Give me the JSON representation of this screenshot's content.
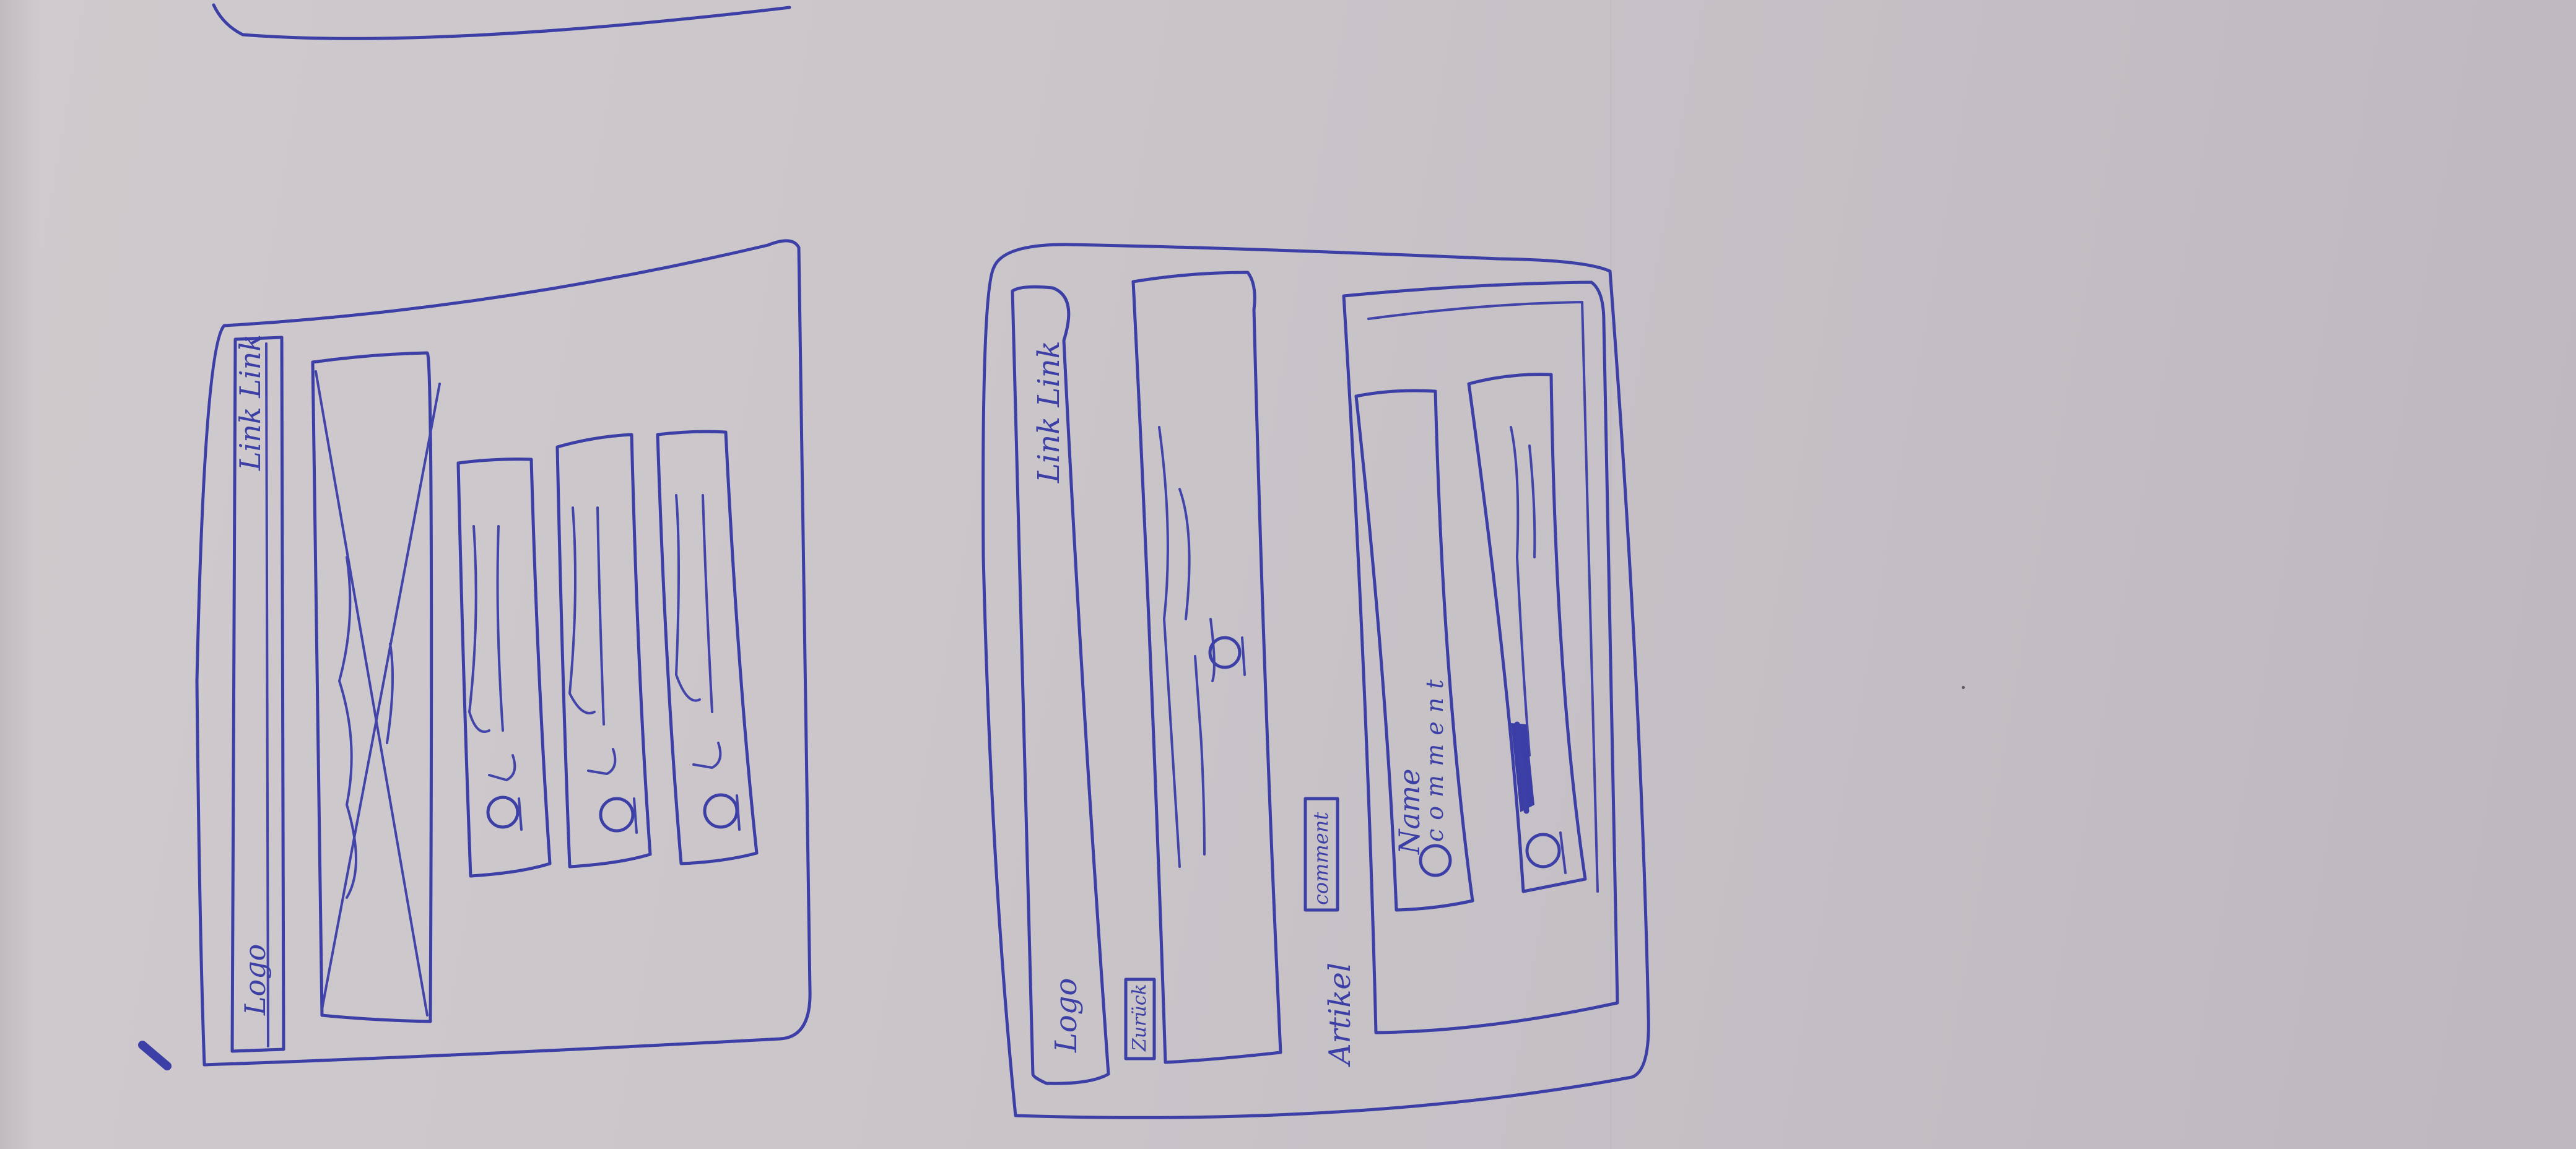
{
  "wireframe_home": {
    "nav_links": "Link Link",
    "logo": "Logo"
  },
  "wireframe_article": {
    "nav_links": "Link Link",
    "logo": "Logo",
    "button": "Zurück",
    "article_heading": "Artikel",
    "comment_button": "comment",
    "comment_name": "Name",
    "comment_text": "comment"
  },
  "colors": {
    "paper": "#cbc6ca",
    "ink": "#3c3fa6"
  }
}
